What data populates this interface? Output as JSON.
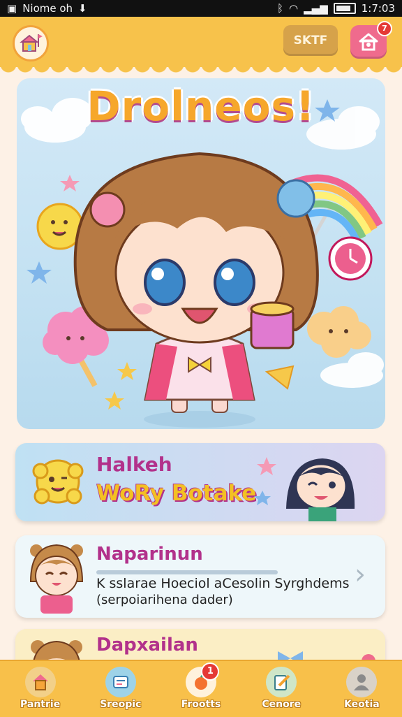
{
  "status_bar": {
    "left_text": "Niome oh",
    "time": "1:7:03"
  },
  "header": {
    "skip_label": "SKTF",
    "home_badge": "7"
  },
  "hero": {
    "title": "Drolneos!"
  },
  "cards": [
    {
      "title": "Halkeh",
      "subtitle": "WoRy Botake"
    },
    {
      "title": "Naparinun",
      "description": "K sslarae Hoeciol aCesolin Syrghdems",
      "description2": "(serpoiarihena dader)"
    },
    {
      "title": "Dapxailan"
    }
  ],
  "tabs": [
    {
      "label": "Pantrie"
    },
    {
      "label": "Sreopic"
    },
    {
      "label": "Frootts",
      "badge": "1"
    },
    {
      "label": "Cenore"
    },
    {
      "label": "Keotia"
    }
  ],
  "colors": {
    "topbar": "#f7c24b",
    "accent_pink": "#ef6b8d",
    "title_magenta": "#b2318b",
    "sky": "#c3e1f2"
  }
}
